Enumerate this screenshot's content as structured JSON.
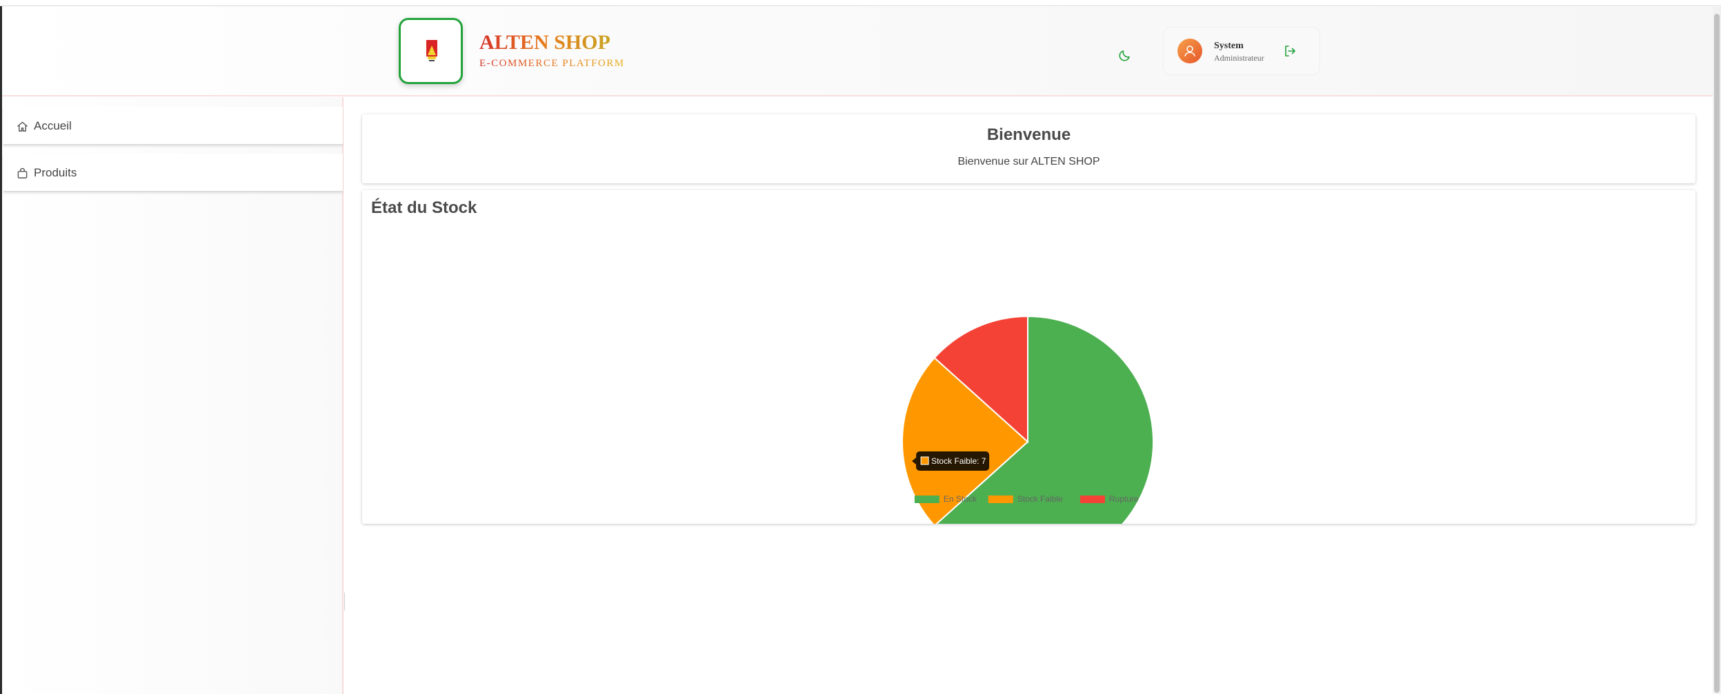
{
  "header": {
    "brand_title": "ALTEN SHOP",
    "brand_subtitle": "E-COMMERCE PLATFORM",
    "theme_toggle_icon": "moon-icon",
    "logout_icon": "logout-icon",
    "user": {
      "name": "System",
      "role": "Administrateur",
      "avatar_icon": "user-icon"
    }
  },
  "sidebar": {
    "items": [
      {
        "label": "Accueil",
        "icon": "home-icon"
      },
      {
        "label": "Produits",
        "icon": "shopping-bag-icon"
      }
    ]
  },
  "main": {
    "welcome_title": "Bienvenue",
    "welcome_text": "Bienvenue sur ALTEN SHOP",
    "stock_title": "État du Stock"
  },
  "colors": {
    "en_stock": "#4caf50",
    "stock_faible": "#ff9800",
    "rupture": "#f44336",
    "accent_green": "#22a33a"
  },
  "chart_data": {
    "type": "pie",
    "categories": [
      "En Stock",
      "Stock Faible",
      "Rupture"
    ],
    "values": [
      19,
      7,
      4
    ],
    "legend_position": "bottom",
    "tooltip": {
      "category": "Stock Faible",
      "text": "Stock Faible: 7"
    }
  }
}
